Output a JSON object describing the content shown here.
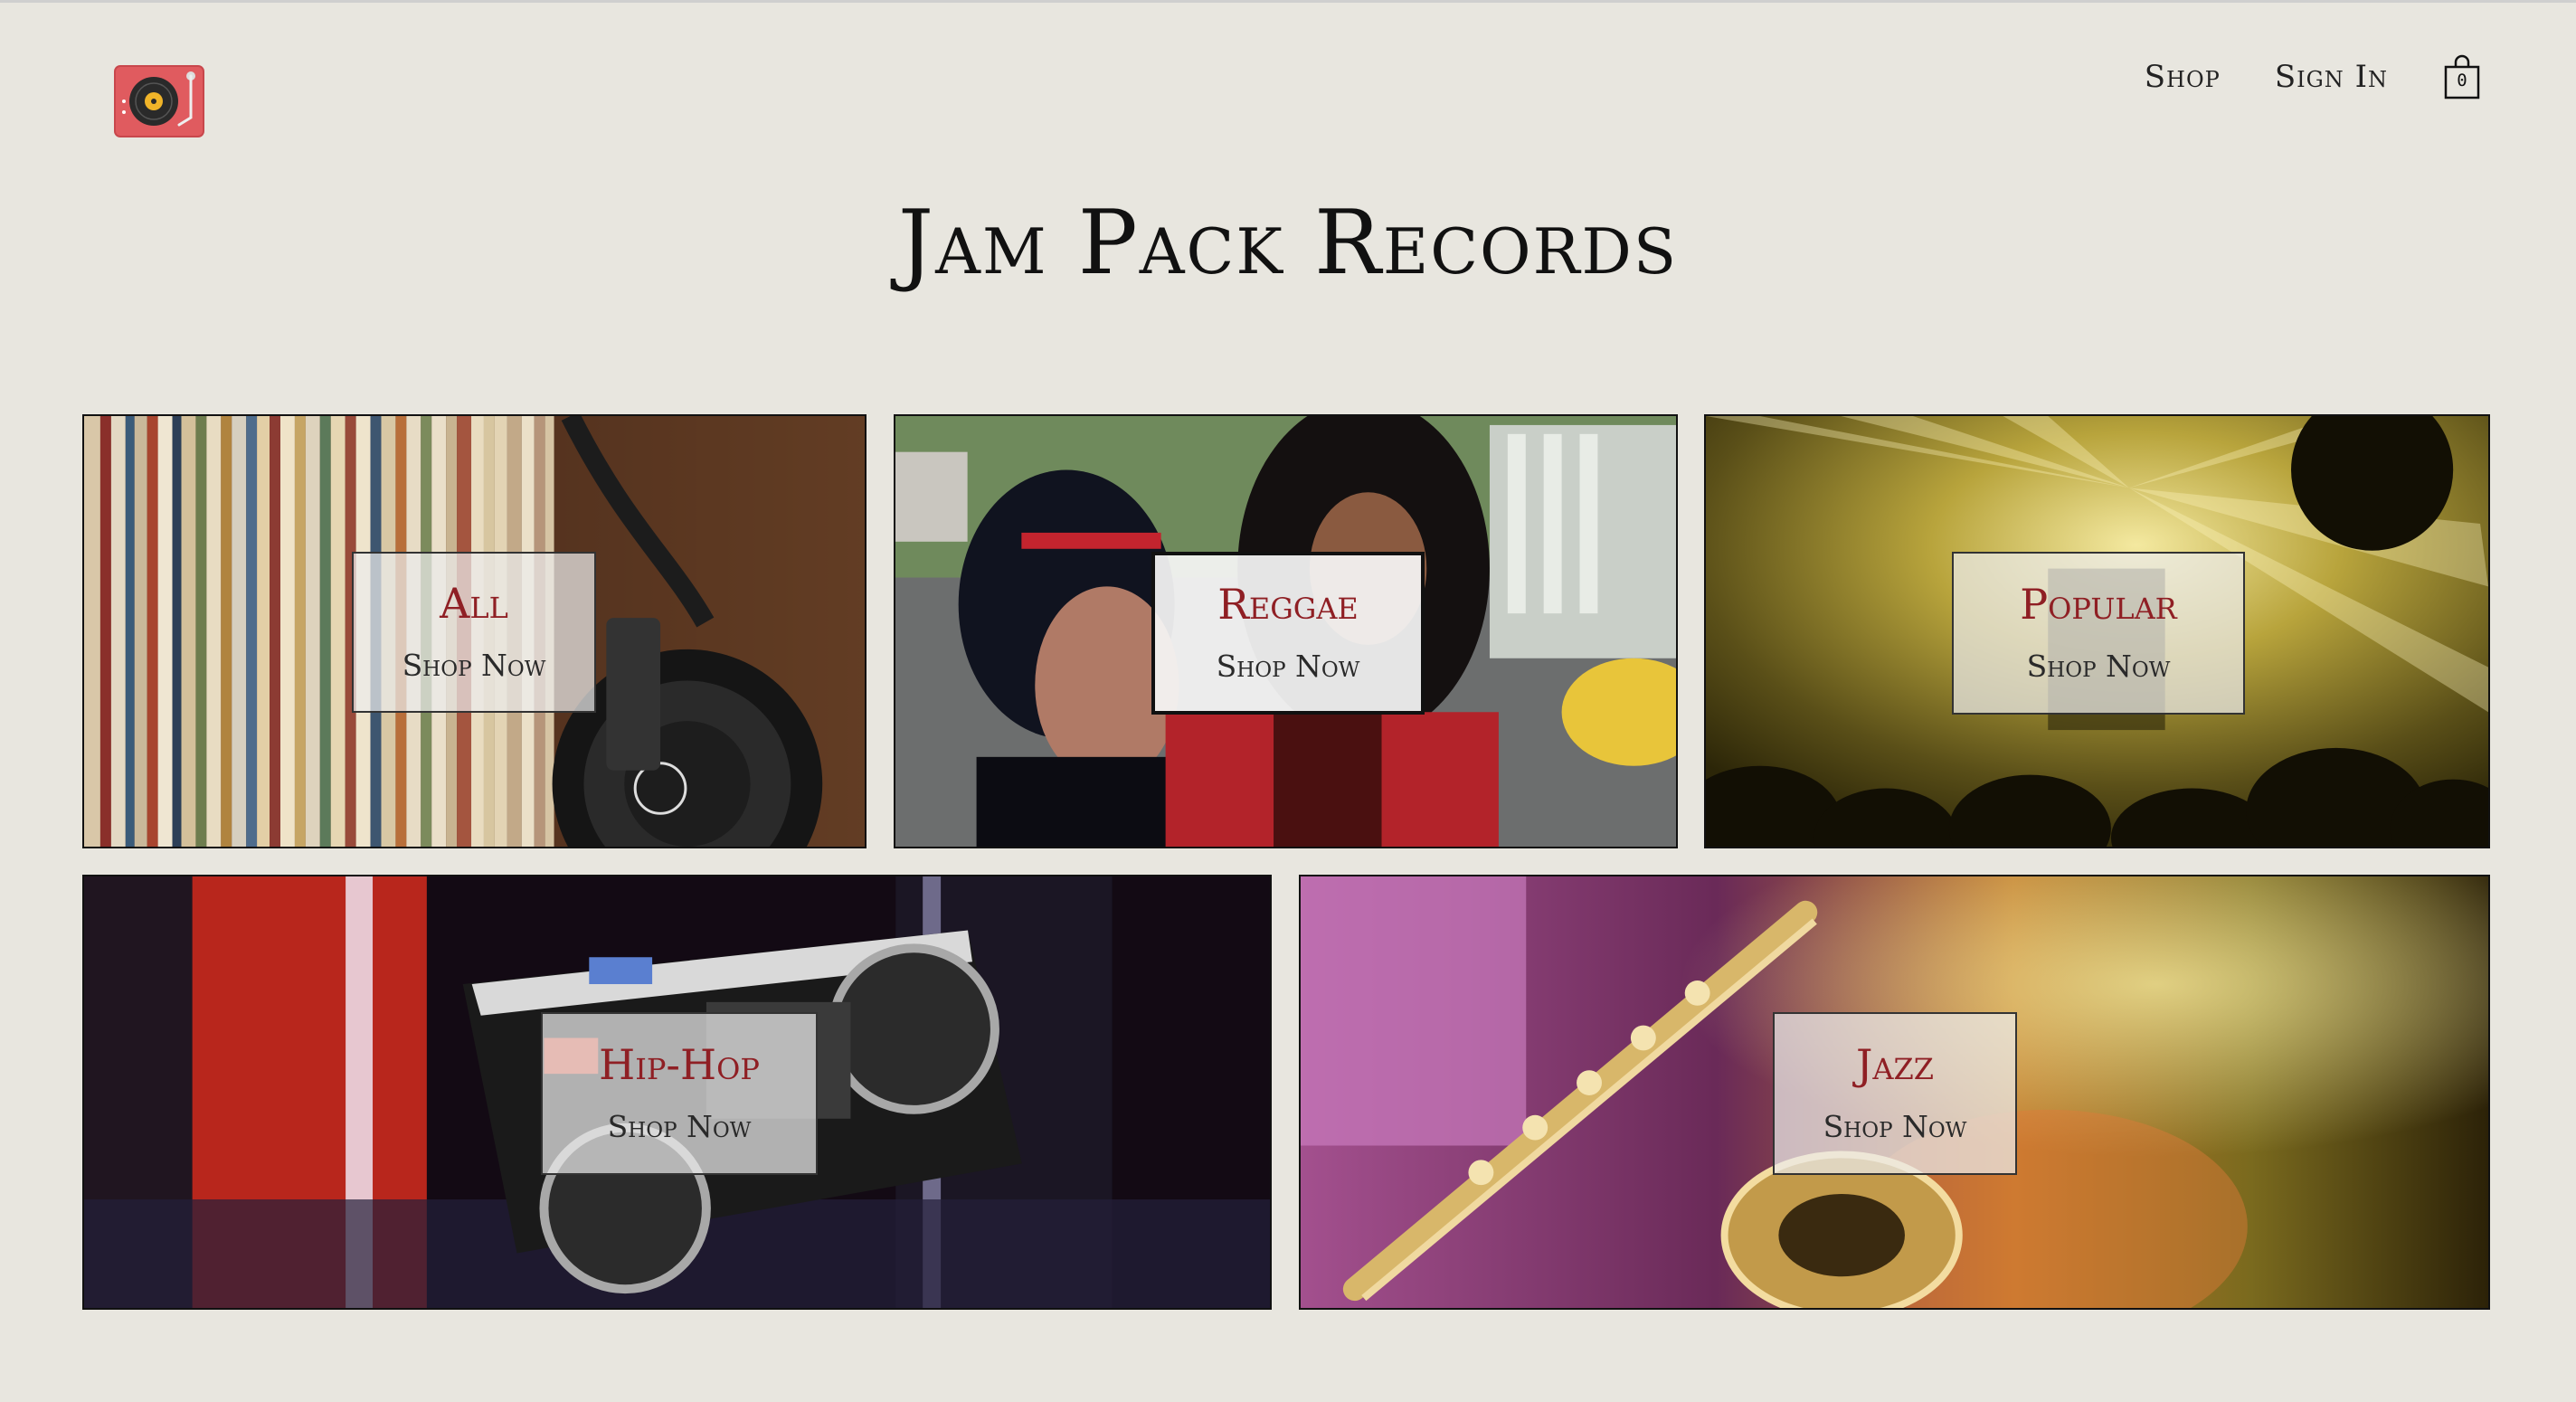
{
  "header": {
    "logo_icon": "turntable-icon",
    "nav": {
      "shop_label": "Shop",
      "signin_label": "Sign In"
    },
    "cart": {
      "icon": "shopping-bag-icon",
      "count": "0"
    }
  },
  "page_title": "Jam Pack Records",
  "categories": [
    {
      "title": "All",
      "cta": "Shop Now"
    },
    {
      "title": "Reggae",
      "cta": "Shop Now"
    },
    {
      "title": "Popular",
      "cta": "Shop Now"
    },
    {
      "title": "Hip-Hop",
      "cta": "Shop Now"
    },
    {
      "title": "Jazz",
      "cta": "Shop Now"
    }
  ],
  "colors": {
    "background": "#e8e6df",
    "accent_title": "#8f1f24",
    "logo": "#e05b5f"
  }
}
